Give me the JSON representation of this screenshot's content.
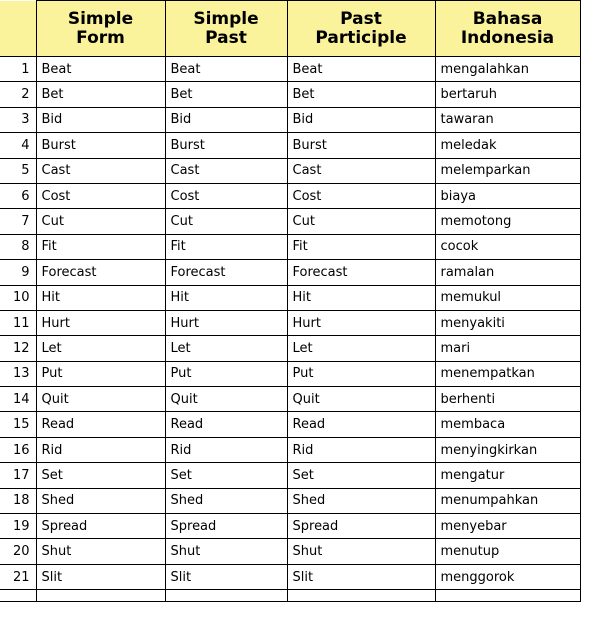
{
  "table": {
    "name": "irregular-verbs-table",
    "columns": [
      {
        "key": "num",
        "label": ""
      },
      {
        "key": "simple_form",
        "label": "Simple Form"
      },
      {
        "key": "simple_past",
        "label": "Simple Past"
      },
      {
        "key": "past_participle",
        "label": "Past Participle"
      },
      {
        "key": "bahasa_indonesia",
        "label": "Bahasa Indonesia"
      }
    ],
    "header_background": "#faf39c",
    "border_color": "#000000",
    "rows": [
      {
        "num": "1",
        "simple_form": "Beat",
        "simple_past": "Beat",
        "past_participle": "Beat",
        "bahasa_indonesia": "mengalahkan"
      },
      {
        "num": "2",
        "simple_form": "Bet",
        "simple_past": "Bet",
        "past_participle": "Bet",
        "bahasa_indonesia": "bertaruh"
      },
      {
        "num": "3",
        "simple_form": "Bid",
        "simple_past": "Bid",
        "past_participle": "Bid",
        "bahasa_indonesia": "tawaran"
      },
      {
        "num": "4",
        "simple_form": "Burst",
        "simple_past": "Burst",
        "past_participle": "Burst",
        "bahasa_indonesia": "meledak"
      },
      {
        "num": "5",
        "simple_form": "Cast",
        "simple_past": "Cast",
        "past_participle": "Cast",
        "bahasa_indonesia": "melemparkan"
      },
      {
        "num": "6",
        "simple_form": "Cost",
        "simple_past": "Cost",
        "past_participle": "Cost",
        "bahasa_indonesia": "biaya"
      },
      {
        "num": "7",
        "simple_form": "Cut",
        "simple_past": "Cut",
        "past_participle": "Cut",
        "bahasa_indonesia": "memotong"
      },
      {
        "num": "8",
        "simple_form": "Fit",
        "simple_past": "Fit",
        "past_participle": "Fit",
        "bahasa_indonesia": "cocok"
      },
      {
        "num": "9",
        "simple_form": "Forecast",
        "simple_past": "Forecast",
        "past_participle": "Forecast",
        "bahasa_indonesia": "ramalan"
      },
      {
        "num": "10",
        "simple_form": "Hit",
        "simple_past": "Hit",
        "past_participle": "Hit",
        "bahasa_indonesia": "memukul"
      },
      {
        "num": "11",
        "simple_form": "Hurt",
        "simple_past": "Hurt",
        "past_participle": "Hurt",
        "bahasa_indonesia": "menyakiti"
      },
      {
        "num": "12",
        "simple_form": "Let",
        "simple_past": "Let",
        "past_participle": "Let",
        "bahasa_indonesia": "mari"
      },
      {
        "num": "13",
        "simple_form": "Put",
        "simple_past": "Put",
        "past_participle": "Put",
        "bahasa_indonesia": "menempatkan"
      },
      {
        "num": "14",
        "simple_form": "Quit",
        "simple_past": "Quit",
        "past_participle": "Quit",
        "bahasa_indonesia": "berhenti"
      },
      {
        "num": "15",
        "simple_form": "Read",
        "simple_past": "Read",
        "past_participle": "Read",
        "bahasa_indonesia": "membaca"
      },
      {
        "num": "16",
        "simple_form": "Rid",
        "simple_past": "Rid",
        "past_participle": "Rid",
        "bahasa_indonesia": "menyingkirkan"
      },
      {
        "num": "17",
        "simple_form": "Set",
        "simple_past": "Set",
        "past_participle": "Set",
        "bahasa_indonesia": "mengatur"
      },
      {
        "num": "18",
        "simple_form": "Shed",
        "simple_past": "Shed",
        "past_participle": "Shed",
        "bahasa_indonesia": "menumpahkan"
      },
      {
        "num": "19",
        "simple_form": "Spread",
        "simple_past": "Spread",
        "past_participle": "Spread",
        "bahasa_indonesia": "menyebar"
      },
      {
        "num": "20",
        "simple_form": "Shut",
        "simple_past": "Shut",
        "past_participle": "Shut",
        "bahasa_indonesia": "menutup"
      },
      {
        "num": "21",
        "simple_form": "Slit",
        "simple_past": "Slit",
        "past_participle": "Slit",
        "bahasa_indonesia": "menggorok"
      },
      {
        "num": "",
        "simple_form": "",
        "simple_past": "",
        "past_participle": "",
        "bahasa_indonesia": "",
        "clipped": true
      }
    ]
  }
}
